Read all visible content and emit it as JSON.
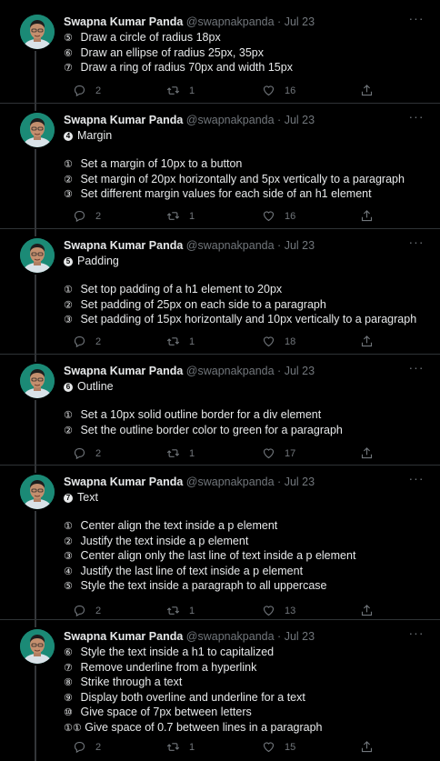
{
  "author": {
    "name": "Swapna Kumar Panda",
    "handle": "@swapnakpanda",
    "separator": "·"
  },
  "tweets": [
    {
      "date": "Jul 23",
      "section": null,
      "items": [
        {
          "num": "⑤",
          "text": "Draw a circle of radius 18px"
        },
        {
          "num": "⑥",
          "text": "Draw an ellipse of radius 25px, 35px"
        },
        {
          "num": "⑦",
          "text": "Draw a ring of radius 70px and width 15px"
        }
      ],
      "replies": "2",
      "retweets": "1",
      "likes": "16"
    },
    {
      "date": "Jul 23",
      "section": {
        "icon": "4",
        "title": "Margin"
      },
      "items": [
        {
          "num": "①",
          "text": "Set a margin of 10px to a button"
        },
        {
          "num": "②",
          "text": "Set margin of 20px horizontally and 5px vertically to a paragraph"
        },
        {
          "num": "③",
          "text": "Set different margin values for each side of an h1 element"
        }
      ],
      "replies": "2",
      "retweets": "1",
      "likes": "16"
    },
    {
      "date": "Jul 23",
      "section": {
        "icon": "5",
        "title": "Padding"
      },
      "items": [
        {
          "num": "①",
          "text": "Set top padding of a h1 element to 20px"
        },
        {
          "num": "②",
          "text": "Set padding of 25px on each side to a paragraph"
        },
        {
          "num": "③",
          "text": "Set padding of 15px horizontally and 10px vertically to a paragraph"
        }
      ],
      "replies": "2",
      "retweets": "1",
      "likes": "18"
    },
    {
      "date": "Jul 23",
      "section": {
        "icon": "6",
        "title": "Outline"
      },
      "items": [
        {
          "num": "①",
          "text": "Set a 10px solid outline border for a div element"
        },
        {
          "num": "②",
          "text": "Set the outline border color to green for a paragraph"
        }
      ],
      "replies": "2",
      "retweets": "1",
      "likes": "17"
    },
    {
      "date": "Jul 23",
      "section": {
        "icon": "7",
        "title": "Text"
      },
      "items": [
        {
          "num": "①",
          "text": "Center align the text inside a p element"
        },
        {
          "num": "②",
          "text": "Justify the text inside a p element"
        },
        {
          "num": "③",
          "text": "Center align only the last line of text inside a p element"
        },
        {
          "num": "④",
          "text": "Justify the last line of text inside a p element"
        },
        {
          "num": "⑤",
          "text": "Style the text inside a paragraph to all uppercase"
        }
      ],
      "replies": "2",
      "retweets": "1",
      "likes": "13"
    },
    {
      "date": "Jul 23",
      "section": null,
      "items": [
        {
          "num": "⑥",
          "text": "Style the text inside a h1 to capitalized"
        },
        {
          "num": "⑦",
          "text": "Remove underline from a hyperlink"
        },
        {
          "num": "⑧",
          "text": "Strike through a text"
        },
        {
          "num": "⑨",
          "text": "Display both overline and underline for a text"
        },
        {
          "num": "⑩",
          "text": "Give space of 7px between letters"
        },
        {
          "num": "①①",
          "text": "Give space of 0.7 between lines in a paragraph"
        }
      ],
      "replies": "2",
      "retweets": "1",
      "likes": "15"
    }
  ]
}
